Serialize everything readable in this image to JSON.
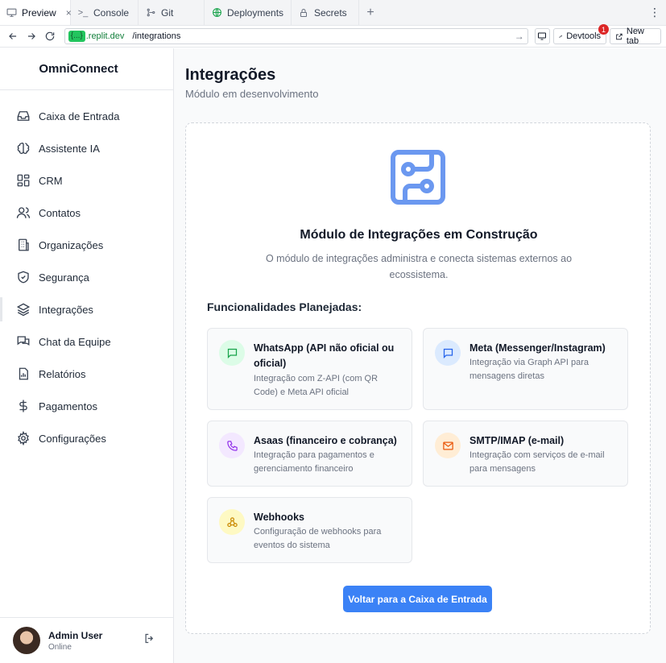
{
  "browser": {
    "tabs": [
      {
        "label": "Preview",
        "icon": "monitor-icon",
        "active": true,
        "close": "×"
      },
      {
        "label": "Console",
        "icon": "terminal-icon"
      },
      {
        "label": "Git",
        "icon": "git-icon"
      },
      {
        "label": "Deployments",
        "icon": "globe-icon"
      },
      {
        "label": "Secrets",
        "icon": "lock-icon"
      }
    ],
    "new_tab_plus": "+",
    "menu": "⋮",
    "url": {
      "host_masked": "{...}",
      "domain": ".replit.dev",
      "path": "/integrations"
    },
    "devtools_label": "Devtools",
    "devtools_badge": "1",
    "new_tab_label": "New tab"
  },
  "sidebar": {
    "brand": "OmniConnect",
    "items": [
      {
        "label": "Caixa de Entrada",
        "icon": "inbox-icon"
      },
      {
        "label": "Assistente IA",
        "icon": "brain-icon"
      },
      {
        "label": "CRM",
        "icon": "layout-grid-icon"
      },
      {
        "label": "Contatos",
        "icon": "users-icon"
      },
      {
        "label": "Organizações",
        "icon": "building-icon"
      },
      {
        "label": "Segurança",
        "icon": "shield-icon"
      },
      {
        "label": "Integrações",
        "icon": "layers-icon",
        "active": true
      },
      {
        "label": "Chat da Equipe",
        "icon": "chat-icon"
      },
      {
        "label": "Relatórios",
        "icon": "report-icon"
      },
      {
        "label": "Pagamentos",
        "icon": "dollar-icon"
      },
      {
        "label": "Configurações",
        "icon": "gear-icon"
      }
    ],
    "user": {
      "name": "Admin User",
      "status": "Online"
    }
  },
  "main": {
    "title": "Integrações",
    "subtitle": "Módulo em desenvolvimento",
    "card": {
      "icon": "circuit-icon",
      "title": "Módulo de Integrações em Construção",
      "description": "O módulo de integrações administra e conecta sistemas externos ao ecossistema.",
      "features_title": "Funcionalidades Planejadas:",
      "features": [
        {
          "title": "WhatsApp (API não oficial ou oficial)",
          "description": "Integração com Z-API (com QR Code) e Meta API oficial",
          "icon": "message-square-icon",
          "color": "#16a34a",
          "bg": "#dcfce7"
        },
        {
          "title": "Meta (Messenger/Instagram)",
          "description": "Integração via Graph API para mensagens diretas",
          "icon": "message-square-icon",
          "color": "#2563eb",
          "bg": "#dbeafe"
        },
        {
          "title": "Asaas (financeiro e cobrança)",
          "description": "Integração para pagamentos e gerenciamento financeiro",
          "icon": "phone-icon",
          "color": "#9333ea",
          "bg": "#f3e8ff"
        },
        {
          "title": "SMTP/IMAP (e-mail)",
          "description": "Integração com serviços de e-mail para mensagens",
          "icon": "mail-icon",
          "color": "#ea580c",
          "bg": "#ffedd5"
        },
        {
          "title": "Webhooks",
          "description": "Configuração de webhooks para eventos do sistema",
          "icon": "webhook-icon",
          "color": "#ca8a04",
          "bg": "#fef9c3"
        }
      ],
      "button": "Voltar para a Caixa de Entrada"
    }
  },
  "colors": {
    "accent": "#3b82f6",
    "hero_icon": "#6b98f0"
  }
}
